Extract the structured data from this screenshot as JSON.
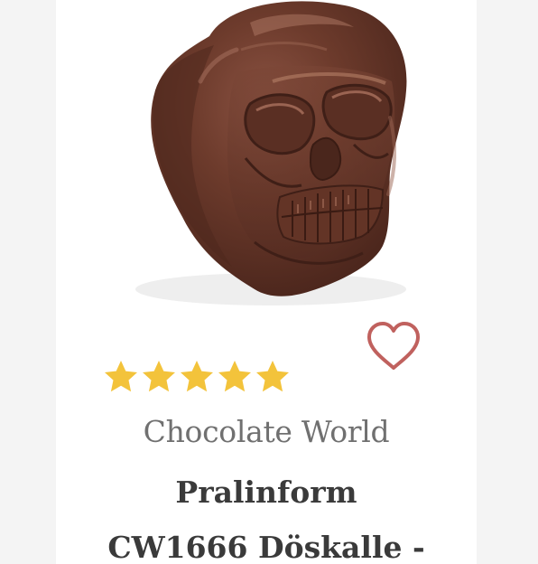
{
  "product": {
    "image_alt": "Chocolate skull praline",
    "rating": 5,
    "rating_max": 5,
    "brand": "Chocolate World",
    "title_lines": [
      "Pralinform",
      "CW1666 Döskalle -"
    ],
    "wishlist_icon": "heart-outline-icon",
    "star_icon": "star-icon"
  },
  "colors": {
    "star": "#f3c33b",
    "heart": "#c0615e",
    "brand_text": "#707070",
    "title_text": "#3a3a3a",
    "chocolate": "#6a3a2c"
  }
}
